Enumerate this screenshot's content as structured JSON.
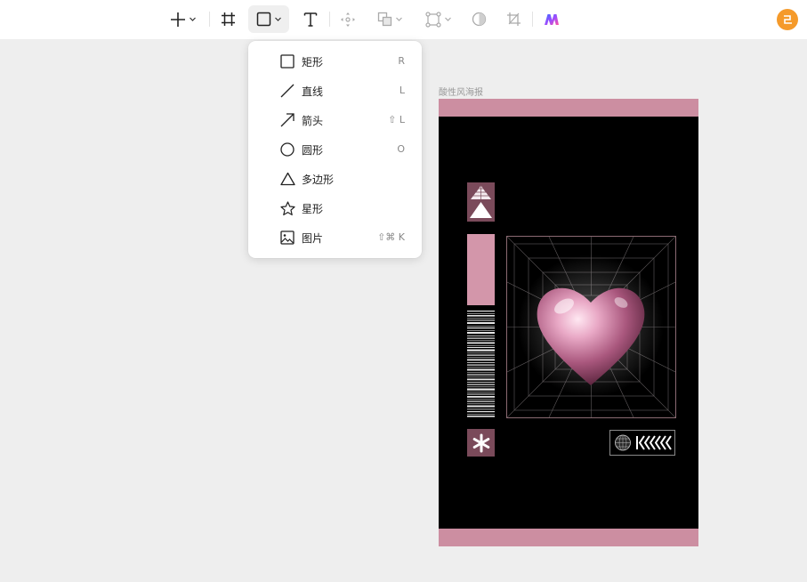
{
  "toolbar": {
    "tools": [
      {
        "name": "add",
        "icon": "plus-icon",
        "has_dropdown": true
      },
      {
        "name": "frame",
        "icon": "frame-icon",
        "has_dropdown": false
      },
      {
        "name": "shape",
        "icon": "rectangle-icon",
        "has_dropdown": true,
        "active": true
      },
      {
        "name": "text",
        "icon": "text-icon",
        "has_dropdown": false
      },
      {
        "name": "move",
        "icon": "move-icon",
        "has_dropdown": false
      },
      {
        "name": "boolean",
        "icon": "boolean-icon",
        "has_dropdown": true
      },
      {
        "name": "component",
        "icon": "component-icon",
        "has_dropdown": true
      },
      {
        "name": "mask",
        "icon": "mask-icon",
        "has_dropdown": false
      },
      {
        "name": "crop",
        "icon": "crop-icon",
        "has_dropdown": false
      },
      {
        "name": "ai",
        "icon": "ai-logo-icon",
        "has_dropdown": false
      }
    ],
    "avatar_icon": "user-avatar-icon",
    "avatar_color": "#f59a2a"
  },
  "shape_menu": {
    "items": [
      {
        "label": "矩形",
        "shortcut": "R",
        "icon": "rectangle-icon"
      },
      {
        "label": "直线",
        "shortcut": "L",
        "icon": "line-icon"
      },
      {
        "label": "箭头",
        "shortcut": "⇧ L",
        "icon": "arrow-icon"
      },
      {
        "label": "圆形",
        "shortcut": "O",
        "icon": "circle-icon"
      },
      {
        "label": "多边形",
        "shortcut": "",
        "icon": "triangle-icon"
      },
      {
        "label": "星形",
        "shortcut": "",
        "icon": "star-icon"
      },
      {
        "label": "图片",
        "shortcut": "⇧⌘ K",
        "icon": "image-icon"
      }
    ]
  },
  "canvas": {
    "frame_label": "酸性风海报",
    "colors": {
      "background": "#000000",
      "band": "#cc8ea1",
      "accent_dark": "#7a4a5a",
      "accent_light": "#d396aa",
      "heart": "#e7a9c3"
    }
  }
}
